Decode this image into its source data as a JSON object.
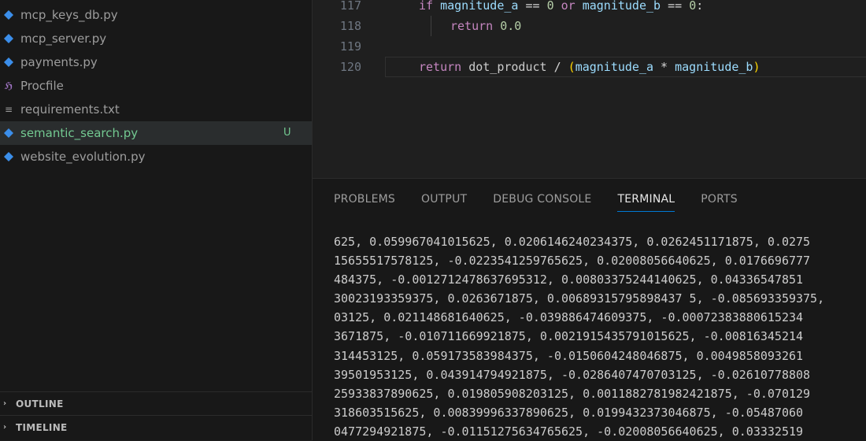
{
  "explorer": {
    "files": [
      {
        "name": "mcp_keys_db.py",
        "icon": "python-icon",
        "color": "#3b8eea"
      },
      {
        "name": "mcp_server.py",
        "icon": "python-icon",
        "color": "#3b8eea"
      },
      {
        "name": "payments.py",
        "icon": "python-icon",
        "color": "#3b8eea"
      },
      {
        "name": "Procfile",
        "icon": "heroku-icon",
        "color": "#a074c4"
      },
      {
        "name": "requirements.txt",
        "icon": "text-file-icon",
        "color": "#9d9d9d"
      },
      {
        "name": "semantic_search.py",
        "icon": "python-icon",
        "color": "#3b8eea",
        "active": true,
        "badge": "U"
      },
      {
        "name": "website_evolution.py",
        "icon": "python-icon",
        "color": "#3b8eea"
      }
    ],
    "outline_label": "OUTLINE",
    "timeline_label": "TIMELINE"
  },
  "editor": {
    "lines": [
      {
        "number": "117",
        "kw1": "if",
        "var1": "magnitude_a",
        "op1": " == ",
        "num1": "0",
        "kw2": " or ",
        "var2": "magnitude_b",
        "op2": " == ",
        "num2": "0",
        "end": ":"
      },
      {
        "number": "118",
        "kw": "return",
        "value": "0.0"
      },
      {
        "number": "119"
      },
      {
        "number": "120",
        "kw": "return",
        "var1": "dot_product",
        "op": " / ",
        "open": "(",
        "var2": "magnitude_a",
        "op2": " * ",
        "var3": "magnitude_b",
        "close": ")"
      }
    ]
  },
  "panel": {
    "tabs": [
      "PROBLEMS",
      "OUTPUT",
      "DEBUG CONSOLE",
      "TERMINAL",
      "PORTS"
    ],
    "active_tab": "TERMINAL",
    "terminal_lines": [
      "625, 0.059967041015625, 0.0206146240234375, 0.0262451171875, 0.0275",
      "15655517578125, -0.0223541259765625, 0.02008056640625, 0.0176696777",
      "484375, -0.0012712478637695312, 0.00803375244140625, 0.04336547851",
      "30023193359375, 0.0263671875, 0.00689315795898437 5, -0.085693359375,",
      "03125, 0.021148681640625, -0.039886474609375, -0.00072383880615234",
      "3671875, -0.010711669921875, 0.0021915435791015625, -0.00816345214",
      "314453125, 0.059173583984375, -0.0150604248046875, 0.0049858093261",
      "39501953125, 0.043914794921875, -0.0286407470703125, -0.02610778808",
      "25933837890625, 0.019805908203125, 0.0011882781982421875, -0.070129",
      "318603515625, 0.00839996337890625, 0.0199432373046875, -0.05487060",
      "0477294921875, -0.01151275634765625, -0.02008056640625, 0.03332519"
    ]
  }
}
